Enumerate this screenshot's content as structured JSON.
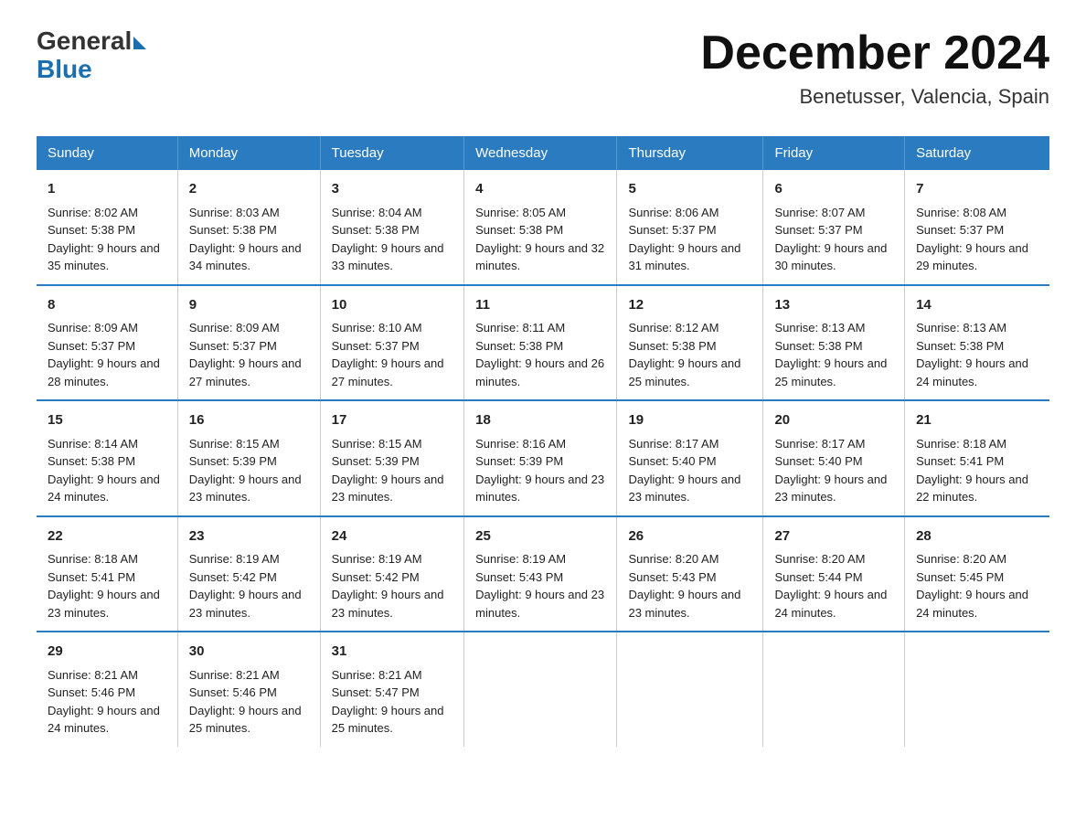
{
  "logo": {
    "line1": "General",
    "line2": "Blue"
  },
  "title": "December 2024",
  "subtitle": "Benetusser, Valencia, Spain",
  "days": [
    "Sunday",
    "Monday",
    "Tuesday",
    "Wednesday",
    "Thursday",
    "Friday",
    "Saturday"
  ],
  "weeks": [
    [
      {
        "day": "1",
        "sunrise": "8:02 AM",
        "sunset": "5:38 PM",
        "daylight": "9 hours and 35 minutes."
      },
      {
        "day": "2",
        "sunrise": "8:03 AM",
        "sunset": "5:38 PM",
        "daylight": "9 hours and 34 minutes."
      },
      {
        "day": "3",
        "sunrise": "8:04 AM",
        "sunset": "5:38 PM",
        "daylight": "9 hours and 33 minutes."
      },
      {
        "day": "4",
        "sunrise": "8:05 AM",
        "sunset": "5:38 PM",
        "daylight": "9 hours and 32 minutes."
      },
      {
        "day": "5",
        "sunrise": "8:06 AM",
        "sunset": "5:37 PM",
        "daylight": "9 hours and 31 minutes."
      },
      {
        "day": "6",
        "sunrise": "8:07 AM",
        "sunset": "5:37 PM",
        "daylight": "9 hours and 30 minutes."
      },
      {
        "day": "7",
        "sunrise": "8:08 AM",
        "sunset": "5:37 PM",
        "daylight": "9 hours and 29 minutes."
      }
    ],
    [
      {
        "day": "8",
        "sunrise": "8:09 AM",
        "sunset": "5:37 PM",
        "daylight": "9 hours and 28 minutes."
      },
      {
        "day": "9",
        "sunrise": "8:09 AM",
        "sunset": "5:37 PM",
        "daylight": "9 hours and 27 minutes."
      },
      {
        "day": "10",
        "sunrise": "8:10 AM",
        "sunset": "5:37 PM",
        "daylight": "9 hours and 27 minutes."
      },
      {
        "day": "11",
        "sunrise": "8:11 AM",
        "sunset": "5:38 PM",
        "daylight": "9 hours and 26 minutes."
      },
      {
        "day": "12",
        "sunrise": "8:12 AM",
        "sunset": "5:38 PM",
        "daylight": "9 hours and 25 minutes."
      },
      {
        "day": "13",
        "sunrise": "8:13 AM",
        "sunset": "5:38 PM",
        "daylight": "9 hours and 25 minutes."
      },
      {
        "day": "14",
        "sunrise": "8:13 AM",
        "sunset": "5:38 PM",
        "daylight": "9 hours and 24 minutes."
      }
    ],
    [
      {
        "day": "15",
        "sunrise": "8:14 AM",
        "sunset": "5:38 PM",
        "daylight": "9 hours and 24 minutes."
      },
      {
        "day": "16",
        "sunrise": "8:15 AM",
        "sunset": "5:39 PM",
        "daylight": "9 hours and 23 minutes."
      },
      {
        "day": "17",
        "sunrise": "8:15 AM",
        "sunset": "5:39 PM",
        "daylight": "9 hours and 23 minutes."
      },
      {
        "day": "18",
        "sunrise": "8:16 AM",
        "sunset": "5:39 PM",
        "daylight": "9 hours and 23 minutes."
      },
      {
        "day": "19",
        "sunrise": "8:17 AM",
        "sunset": "5:40 PM",
        "daylight": "9 hours and 23 minutes."
      },
      {
        "day": "20",
        "sunrise": "8:17 AM",
        "sunset": "5:40 PM",
        "daylight": "9 hours and 23 minutes."
      },
      {
        "day": "21",
        "sunrise": "8:18 AM",
        "sunset": "5:41 PM",
        "daylight": "9 hours and 22 minutes."
      }
    ],
    [
      {
        "day": "22",
        "sunrise": "8:18 AM",
        "sunset": "5:41 PM",
        "daylight": "9 hours and 23 minutes."
      },
      {
        "day": "23",
        "sunrise": "8:19 AM",
        "sunset": "5:42 PM",
        "daylight": "9 hours and 23 minutes."
      },
      {
        "day": "24",
        "sunrise": "8:19 AM",
        "sunset": "5:42 PM",
        "daylight": "9 hours and 23 minutes."
      },
      {
        "day": "25",
        "sunrise": "8:19 AM",
        "sunset": "5:43 PM",
        "daylight": "9 hours and 23 minutes."
      },
      {
        "day": "26",
        "sunrise": "8:20 AM",
        "sunset": "5:43 PM",
        "daylight": "9 hours and 23 minutes."
      },
      {
        "day": "27",
        "sunrise": "8:20 AM",
        "sunset": "5:44 PM",
        "daylight": "9 hours and 24 minutes."
      },
      {
        "day": "28",
        "sunrise": "8:20 AM",
        "sunset": "5:45 PM",
        "daylight": "9 hours and 24 minutes."
      }
    ],
    [
      {
        "day": "29",
        "sunrise": "8:21 AM",
        "sunset": "5:46 PM",
        "daylight": "9 hours and 24 minutes."
      },
      {
        "day": "30",
        "sunrise": "8:21 AM",
        "sunset": "5:46 PM",
        "daylight": "9 hours and 25 minutes."
      },
      {
        "day": "31",
        "sunrise": "8:21 AM",
        "sunset": "5:47 PM",
        "daylight": "9 hours and 25 minutes."
      },
      null,
      null,
      null,
      null
    ]
  ]
}
